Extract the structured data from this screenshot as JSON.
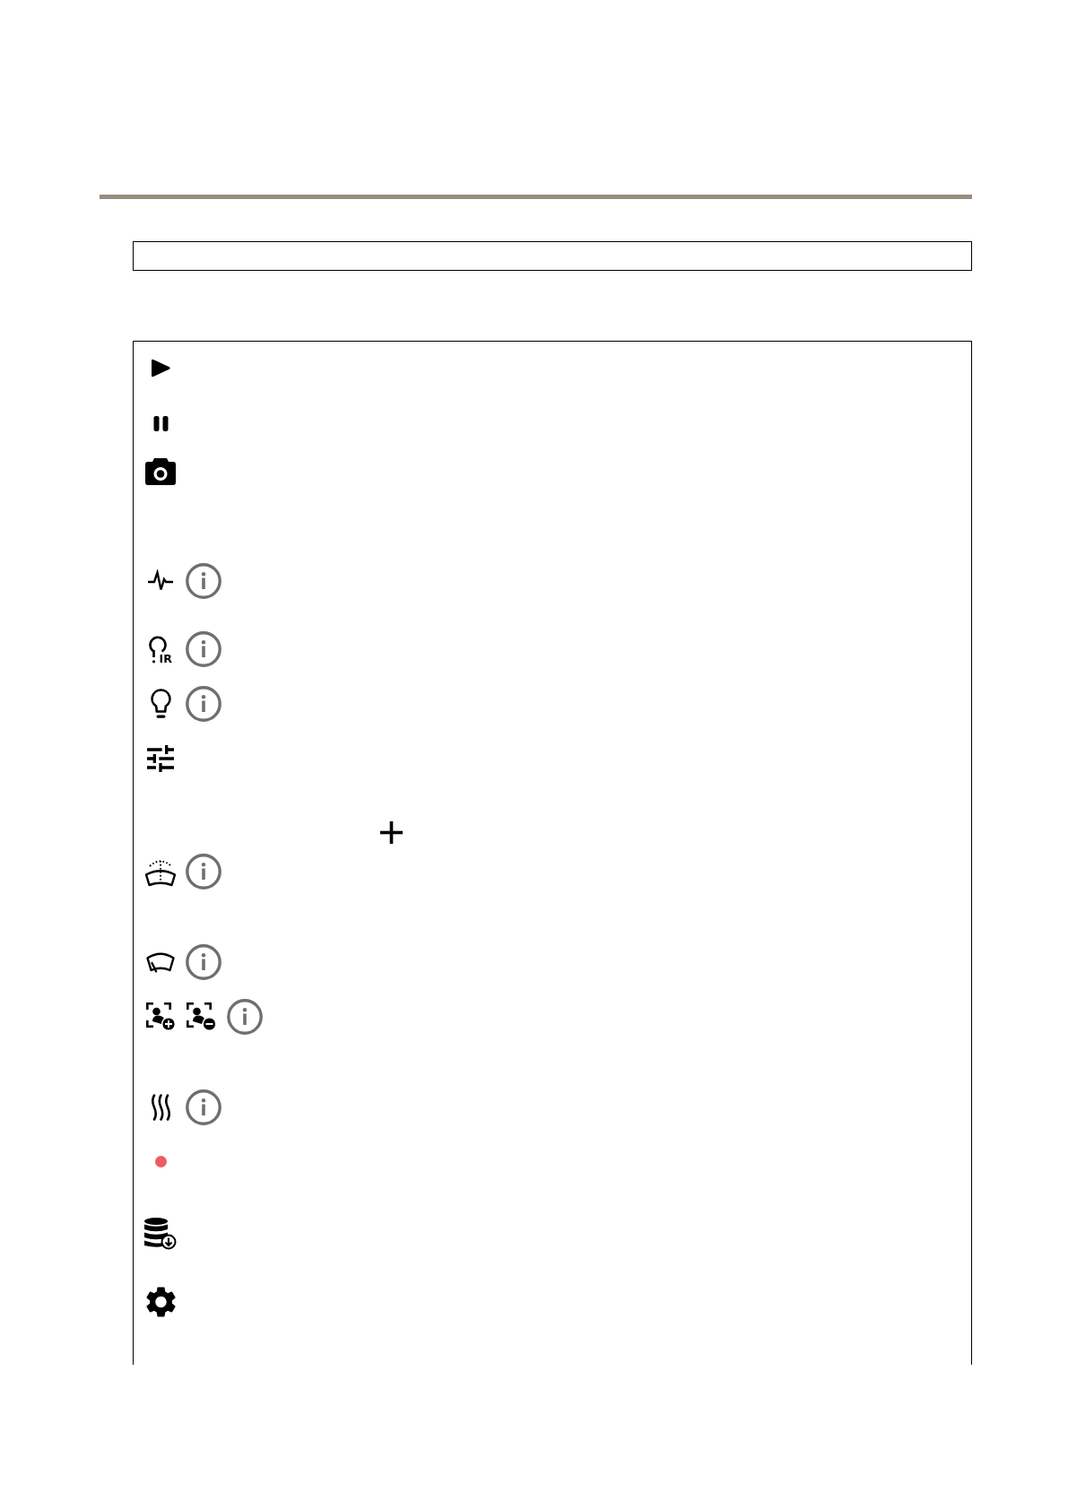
{
  "table": {
    "ir_icon": {
      "label": "IR"
    }
  }
}
